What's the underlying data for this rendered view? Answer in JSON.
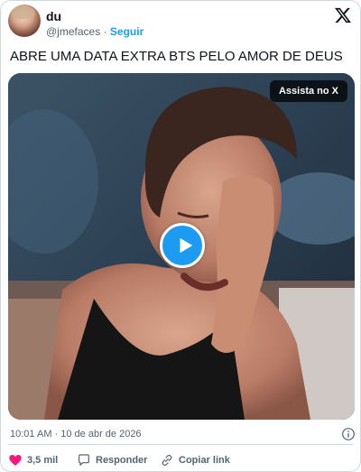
{
  "author": {
    "display_name": "du",
    "handle": "@jmefaces",
    "separator": "·",
    "follow_label": "Seguir"
  },
  "tweet": {
    "text": "ABRE UMA DATA EXTRA BTS PELO AMOR DE DEUS",
    "timestamp": "10:01 AM · 10 de abr de 2026"
  },
  "media": {
    "watch_label": "Assista no X"
  },
  "actions": {
    "like_count": "3,5 mil",
    "reply_label": "Responder",
    "copy_link_label": "Copiar link"
  },
  "icons": {
    "brand": "x-logo-icon",
    "play": "play-icon",
    "info": "info-icon",
    "like": "heart-icon",
    "reply": "reply-bubble-icon",
    "link": "link-icon"
  },
  "colors": {
    "accent": "#1d9bf0",
    "like": "#f91880",
    "text": "#0f1419",
    "muted": "#536471",
    "border": "#cfd9de"
  }
}
